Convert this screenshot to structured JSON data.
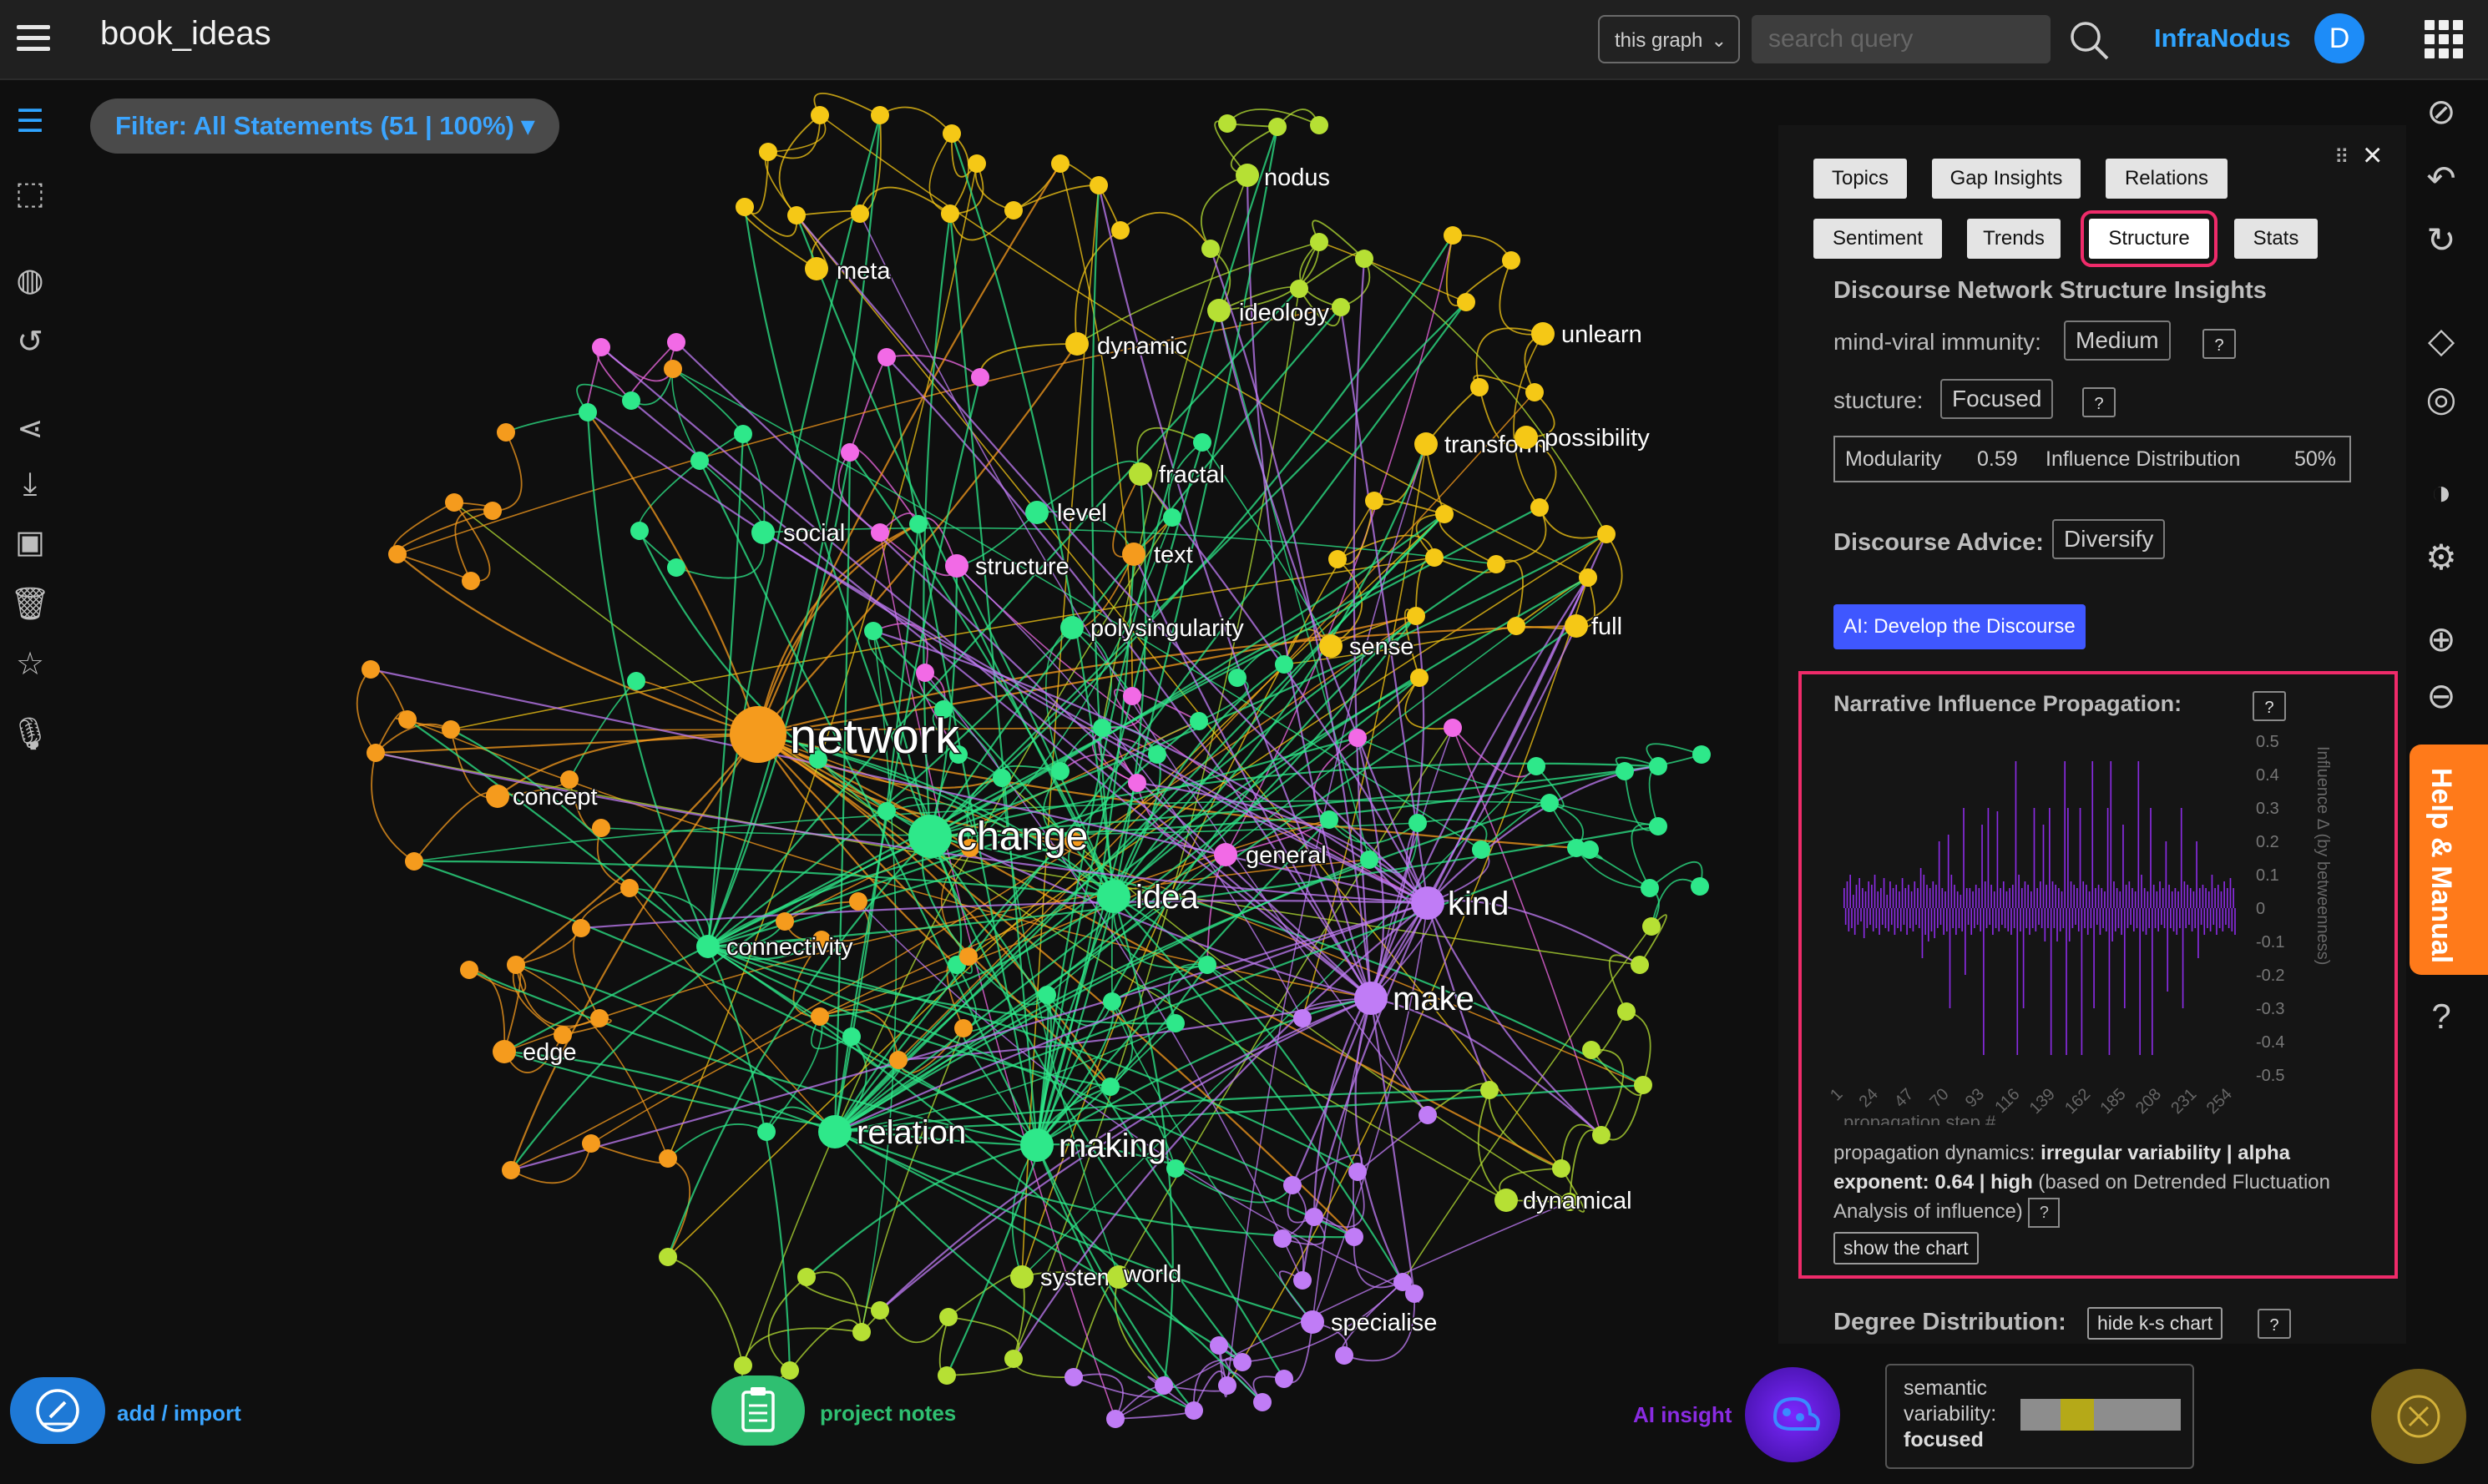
{
  "header": {
    "graph_title": "book_ideas",
    "scope_select": "this graph",
    "search_placeholder": "search query",
    "brand": "InfraNodus",
    "avatar_initial": "D"
  },
  "filter": {
    "label": "Filter: All Statements (51 | 100%) ▾"
  },
  "left_sidebar": [
    {
      "name": "statements-icon",
      "glyph": "☰"
    },
    {
      "name": "select-area-icon",
      "glyph": "⬚"
    },
    {
      "name": "globe-icon",
      "glyph": "◍"
    },
    {
      "name": "history-icon",
      "glyph": "↺"
    },
    {
      "name": "share-icon",
      "glyph": "⋖"
    },
    {
      "name": "download-icon",
      "glyph": "⤓"
    },
    {
      "name": "save-icon",
      "glyph": "▣"
    },
    {
      "name": "trash-icon",
      "glyph": "🗑"
    },
    {
      "name": "star-icon",
      "glyph": "☆"
    },
    {
      "name": "microphone-icon",
      "glyph": "🎙"
    }
  ],
  "graph": {
    "colors": {
      "orange": "#f59b1d",
      "yellow": "#f5c816",
      "green": "#2ee88a",
      "pink": "#f26ae6",
      "purple": "#c07cf6",
      "lime": "#b6e034"
    },
    "nodes": [
      {
        "id": "network",
        "label": "network",
        "color": "orange",
        "size": "xl"
      },
      {
        "id": "change",
        "label": "change",
        "color": "green",
        "size": "l"
      },
      {
        "id": "idea",
        "label": "idea",
        "color": "green",
        "size": "m"
      },
      {
        "id": "make",
        "label": "make",
        "color": "purple",
        "size": "m"
      },
      {
        "id": "kind",
        "label": "kind",
        "color": "purple",
        "size": "m"
      },
      {
        "id": "relation",
        "label": "relation",
        "color": "green",
        "size": "m"
      },
      {
        "id": "making",
        "label": "making",
        "color": "green",
        "size": "m"
      },
      {
        "id": "connectivity",
        "label": "connectivity",
        "color": "green",
        "size": "s"
      },
      {
        "id": "general",
        "label": "general",
        "color": "pink",
        "size": "s"
      },
      {
        "id": "social",
        "label": "social",
        "color": "green",
        "size": "s"
      },
      {
        "id": "level",
        "label": "level",
        "color": "green",
        "size": "s"
      },
      {
        "id": "text",
        "label": "text",
        "color": "orange",
        "size": "s"
      },
      {
        "id": "structure",
        "label": "structure",
        "color": "pink",
        "size": "s"
      },
      {
        "id": "polysingularity",
        "label": "polysingularity",
        "color": "green",
        "size": "s"
      },
      {
        "id": "fractal",
        "label": "fractal",
        "color": "lime",
        "size": "s"
      },
      {
        "id": "meta",
        "label": "meta",
        "color": "yellow",
        "size": "s"
      },
      {
        "id": "dynamic",
        "label": "dynamic",
        "color": "yellow",
        "size": "s"
      },
      {
        "id": "nodus",
        "label": "nodus",
        "color": "lime",
        "size": "s"
      },
      {
        "id": "ideology",
        "label": "ideology",
        "color": "lime",
        "size": "s"
      },
      {
        "id": "unlearn",
        "label": "unlearn",
        "color": "yellow",
        "size": "s"
      },
      {
        "id": "transform",
        "label": "transform",
        "color": "yellow",
        "size": "s"
      },
      {
        "id": "possibility",
        "label": "possibility",
        "color": "yellow",
        "size": "s"
      },
      {
        "id": "full",
        "label": "full",
        "color": "yellow",
        "size": "s"
      },
      {
        "id": "sense",
        "label": "sense",
        "color": "yellow",
        "size": "s"
      },
      {
        "id": "concept",
        "label": "concept",
        "color": "orange",
        "size": "s"
      },
      {
        "id": "edge",
        "label": "edge",
        "color": "orange",
        "size": "s"
      },
      {
        "id": "dynamical",
        "label": "dynamical",
        "color": "lime",
        "size": "s"
      },
      {
        "id": "system",
        "label": "system",
        "color": "lime",
        "size": "s"
      },
      {
        "id": "world",
        "label": "world",
        "color": "lime",
        "size": "s"
      },
      {
        "id": "specialise",
        "label": "specialise",
        "color": "purple",
        "size": "s"
      }
    ]
  },
  "panel": {
    "tabs": [
      {
        "label": "Topics",
        "active": false
      },
      {
        "label": "Gap Insights",
        "active": false
      },
      {
        "label": "Relations",
        "active": false
      },
      {
        "label": "Sentiment",
        "active": false
      },
      {
        "label": "Trends",
        "active": false
      },
      {
        "label": "Structure",
        "active": true
      },
      {
        "label": "Stats",
        "active": false
      }
    ],
    "section_title": "Discourse Network Structure Insights",
    "immunity_label": "mind-viral immunity:",
    "immunity_value": "Medium",
    "structure_label": "stucture:",
    "structure_value": "Focused",
    "modularity_label": "Modularity",
    "modularity_value": "0.59",
    "influence_label": "Influence Distribution",
    "influence_value": "50%",
    "advice_label": "Discourse Advice:",
    "advice_value": "Diversify",
    "ai_button": "AI: Develop the Discourse",
    "narrative_title": "Narrative Influence Propagation:",
    "help_glyph": "?",
    "description_1": "propagation dynamics: ",
    "description_bold_1": "irregular variability | alpha exponent: 0.64 | high",
    "description_2": " (based on Detrended Fluctuation Analysis of influence)",
    "show_chart": "show the chart",
    "degree_title": "Degree Distribution:",
    "hide_ks": "hide k-s chart"
  },
  "chart_data": {
    "type": "bar",
    "title": "",
    "xlabel": "propagation step #",
    "ylabel": "Influence Δ (by betweenness)",
    "ylim": [
      -0.5,
      0.5
    ],
    "x_ticks": [
      "1",
      "24",
      "47",
      "70",
      "93",
      "116",
      "139",
      "162",
      "185",
      "208",
      "231",
      "254"
    ],
    "y_ticks": [
      "0.5",
      "0.4",
      "0.3",
      "0.2",
      "0.1",
      "0",
      "-0.1",
      "-0.2",
      "-0.3",
      "-0.4",
      "-0.5"
    ],
    "color": "#8a2be2",
    "values": [
      0.06,
      -0.05,
      0.08,
      -0.07,
      0.1,
      -0.06,
      0.04,
      -0.08,
      0.07,
      -0.05,
      0.09,
      -0.04,
      0.06,
      -0.09,
      0.05,
      -0.06,
      0.08,
      -0.05,
      0.07,
      -0.07,
      0.1,
      -0.06,
      0.05,
      -0.08,
      0.06,
      -0.05,
      0.09,
      -0.06,
      0.04,
      -0.07,
      0.08,
      -0.05,
      0.06,
      -0.08,
      0.07,
      -0.06,
      0.05,
      -0.07,
      0.09,
      -0.05,
      0.06,
      -0.08,
      0.07,
      -0.06,
      0.05,
      -0.07,
      0.08,
      -0.05,
      0.06,
      -0.06,
      0.12,
      -0.15,
      0.1,
      -0.08,
      0.07,
      -0.1,
      0.06,
      -0.07,
      0.08,
      -0.09,
      0.07,
      -0.06,
      0.2,
      -0.05,
      0.06,
      -0.08,
      0.05,
      -0.07,
      0.22,
      -0.3,
      0.1,
      -0.06,
      0.07,
      -0.08,
      0.05,
      -0.06,
      0.04,
      -0.07,
      0.3,
      -0.2,
      0.06,
      -0.05,
      0.06,
      -0.08,
      0.05,
      -0.06,
      0.07,
      -0.05,
      0.06,
      -0.07,
      0.25,
      -0.44,
      0.08,
      -0.06,
      0.3,
      -0.05,
      0.07,
      -0.08,
      0.05,
      -0.06,
      0.29,
      -0.07,
      0.06,
      -0.05,
      0.08,
      -0.06,
      0.05,
      -0.07,
      0.06,
      -0.08,
      0.07,
      -0.06,
      0.44,
      -0.44,
      0.1,
      -0.07,
      0.06,
      -0.3,
      0.08,
      -0.06,
      0.07,
      -0.08,
      0.05,
      -0.06,
      0.3,
      -0.07,
      0.06,
      -0.05,
      0.08,
      -0.06,
      0.25,
      -0.1,
      0.07,
      -0.06,
      0.3,
      -0.44,
      0.08,
      -0.06,
      0.07,
      -0.1,
      0.06,
      -0.07,
      0.05,
      -0.06,
      0.44,
      -0.44,
      0.3,
      -0.1,
      0.08,
      -0.06,
      0.07,
      -0.05,
      0.06,
      -0.07,
      0.3,
      -0.44,
      0.08,
      -0.06,
      0.07,
      -0.08,
      0.05,
      -0.06,
      0.44,
      -0.3,
      0.06,
      -0.05,
      0.07,
      -0.08,
      0.06,
      -0.06,
      0.05,
      -0.07,
      0.3,
      -0.44,
      0.44,
      -0.1,
      0.08,
      -0.07,
      0.06,
      -0.06,
      0.05,
      -0.08,
      0.25,
      -0.3,
      0.07,
      -0.06,
      0.08,
      -0.05,
      0.06,
      -0.07,
      0.05,
      -0.06,
      0.44,
      -0.44,
      0.1,
      -0.07,
      0.06,
      -0.08,
      0.05,
      -0.06,
      0.3,
      -0.44,
      0.07,
      -0.06,
      0.05,
      -0.07,
      0.08,
      -0.05,
      0.06,
      -0.06,
      0.2,
      -0.25,
      0.07,
      -0.06,
      0.05,
      -0.07,
      0.06,
      -0.08,
      0.05,
      -0.06,
      0.3,
      -0.3,
      0.08,
      -0.06,
      0.07,
      -0.05,
      0.06,
      -0.07,
      0.05,
      -0.06,
      0.2,
      -0.15,
      0.06,
      -0.05,
      0.07,
      -0.08,
      0.06,
      -0.06,
      0.05,
      -0.07,
      0.1,
      -0.05,
      0.06,
      -0.08,
      0.07,
      -0.06,
      0.05,
      -0.07,
      0.08,
      -0.05,
      0.06,
      -0.06,
      0.09,
      -0.07,
      0.06,
      -0.08
    ]
  },
  "right_sidebar": [
    {
      "name": "visibility-icon",
      "glyph": "⊘"
    },
    {
      "name": "view-all-icon",
      "glyph": "↶"
    },
    {
      "name": "refresh-icon",
      "glyph": "↻"
    },
    {
      "name": "diamond-icon",
      "glyph": "◇"
    },
    {
      "name": "target-icon",
      "glyph": "◎"
    },
    {
      "name": "contrast-icon",
      "glyph": "◑"
    },
    {
      "name": "settings-icon",
      "glyph": "⚙"
    },
    {
      "name": "zoom-in-icon",
      "glyph": "⊕"
    },
    {
      "name": "zoom-out-icon",
      "glyph": "⊖"
    },
    {
      "name": "help-icon",
      "glyph": "?"
    }
  ],
  "help_tab": "Help & Manual",
  "bottom": {
    "add_label": "add / import",
    "notes_label": "project notes",
    "ai_label": "AI insight",
    "semvar_label_1": "semantic",
    "semvar_label_2": "variability:",
    "semvar_value": "focused"
  }
}
